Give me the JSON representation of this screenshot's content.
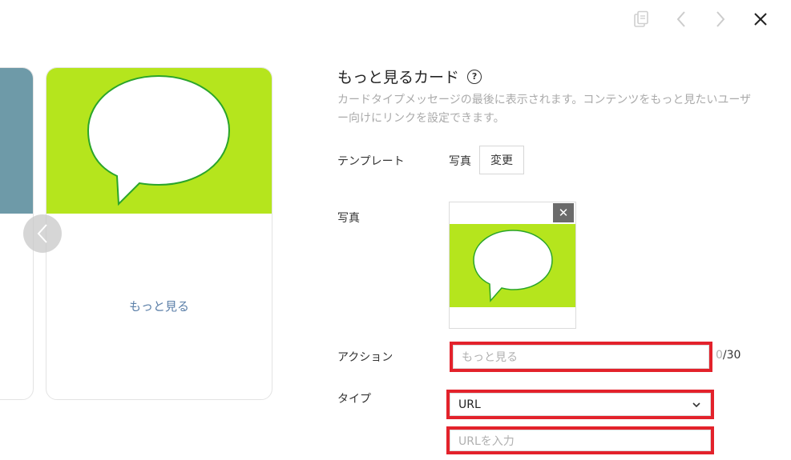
{
  "toolbar": {
    "icons": [
      "copy-icon",
      "chevron-left-icon",
      "chevron-right-icon",
      "close-icon"
    ]
  },
  "preview": {
    "more_label": "もっと見る",
    "card_color": "#b5e51d",
    "side_card_color": "#6e9aa8"
  },
  "form": {
    "title": "もっと見るカード",
    "help_icon_char": "?",
    "description": "カードタイプメッセージの最後に表示されます。コンテンツをもっと見たいユーザー向けにリンクを設定できます。",
    "template": {
      "label": "テンプレート",
      "value": "写真",
      "change_button": "変更"
    },
    "photo": {
      "label": "写真",
      "remove_char": "✕"
    },
    "action": {
      "label": "アクション",
      "placeholder": "もっと見る",
      "count": "0",
      "max": "/30"
    },
    "type": {
      "label": "タイプ",
      "selected": "URL",
      "url_placeholder": "URLを入力"
    },
    "highlight_color": "#e3222b"
  }
}
